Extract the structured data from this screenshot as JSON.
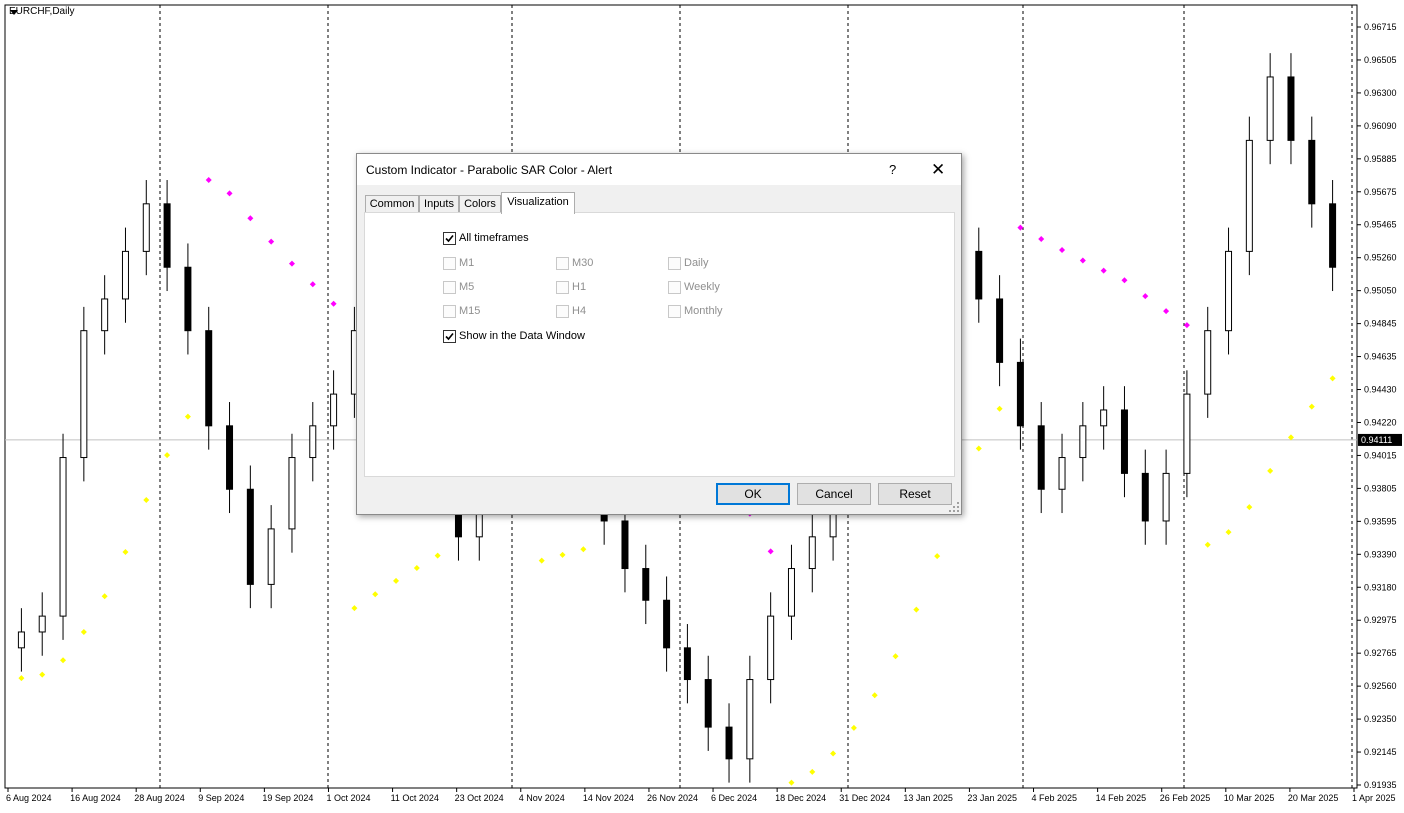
{
  "chart": {
    "symbol": "EURCHF,Daily",
    "current_price": "0.94111",
    "price_labels": [
      "0.96715",
      "0.96505",
      "0.96300",
      "0.96090",
      "0.95885",
      "0.95675",
      "0.95465",
      "0.95260",
      "0.95050",
      "0.94845",
      "0.94635",
      "0.94430",
      "0.94220",
      "0.94015",
      "0.93805",
      "0.93595",
      "0.93390",
      "0.93180",
      "0.92975",
      "0.92765",
      "0.92560",
      "0.92350",
      "0.92145",
      "0.91935"
    ],
    "date_labels": [
      "6 Aug 2024",
      "16 Aug 2024",
      "28 Aug 2024",
      "9 Sep 2024",
      "19 Sep 2024",
      "1 Oct 2024",
      "11 Oct 2024",
      "23 Oct 2024",
      "4 Nov 2024",
      "14 Nov 2024",
      "26 Nov 2024",
      "6 Dec 2024",
      "18 Dec 2024",
      "31 Dec 2024",
      "13 Jan 2025",
      "23 Jan 2025",
      "4 Feb 2025",
      "14 Feb 2025",
      "26 Feb 2025",
      "10 Mar 2025",
      "20 Mar 2025",
      "1 Apr 2025"
    ],
    "colors": {
      "sar_up": "#ffff00",
      "sar_down": "#ff00ff",
      "bull_body": "#ffffff",
      "bear_body": "#000000",
      "separator": "#000000"
    }
  },
  "chart_data": {
    "type": "candlestick",
    "indicator": "Parabolic SAR",
    "closes_approx": [
      0.929,
      0.93,
      0.94,
      0.948,
      0.95,
      0.953,
      0.956,
      0.952,
      0.948,
      0.942,
      0.938,
      0.932,
      0.9355,
      0.94,
      0.942,
      0.944,
      0.948,
      0.951,
      0.947,
      0.943,
      0.938,
      0.935,
      0.94,
      0.945,
      0.948,
      0.95,
      0.944,
      0.939,
      0.936,
      0.933,
      0.931,
      0.928,
      0.926,
      0.923,
      0.921,
      0.926,
      0.93,
      0.933,
      0.935,
      0.938,
      0.94,
      0.942,
      0.944,
      0.947,
      0.95,
      0.953,
      0.95,
      0.946,
      0.942,
      0.938,
      0.94,
      0.942,
      0.943,
      0.939,
      0.936,
      0.939,
      0.944,
      0.948,
      0.953,
      0.96,
      0.964,
      0.96,
      0.956,
      0.952
    ]
  },
  "dialog": {
    "title": "Custom Indicator - Parabolic SAR Color - Alert",
    "help": "?",
    "close": "✕",
    "tabs": [
      "Common",
      "Inputs",
      "Colors",
      "Visualization"
    ],
    "all_timeframes": "All timeframes",
    "timeframes": [
      "M1",
      "M30",
      "Daily",
      "M5",
      "H1",
      "Weekly",
      "M15",
      "H4",
      "Monthly"
    ],
    "data_window": "Show in the Data Window",
    "buttons": {
      "ok": "OK",
      "cancel": "Cancel",
      "reset": "Reset"
    }
  }
}
